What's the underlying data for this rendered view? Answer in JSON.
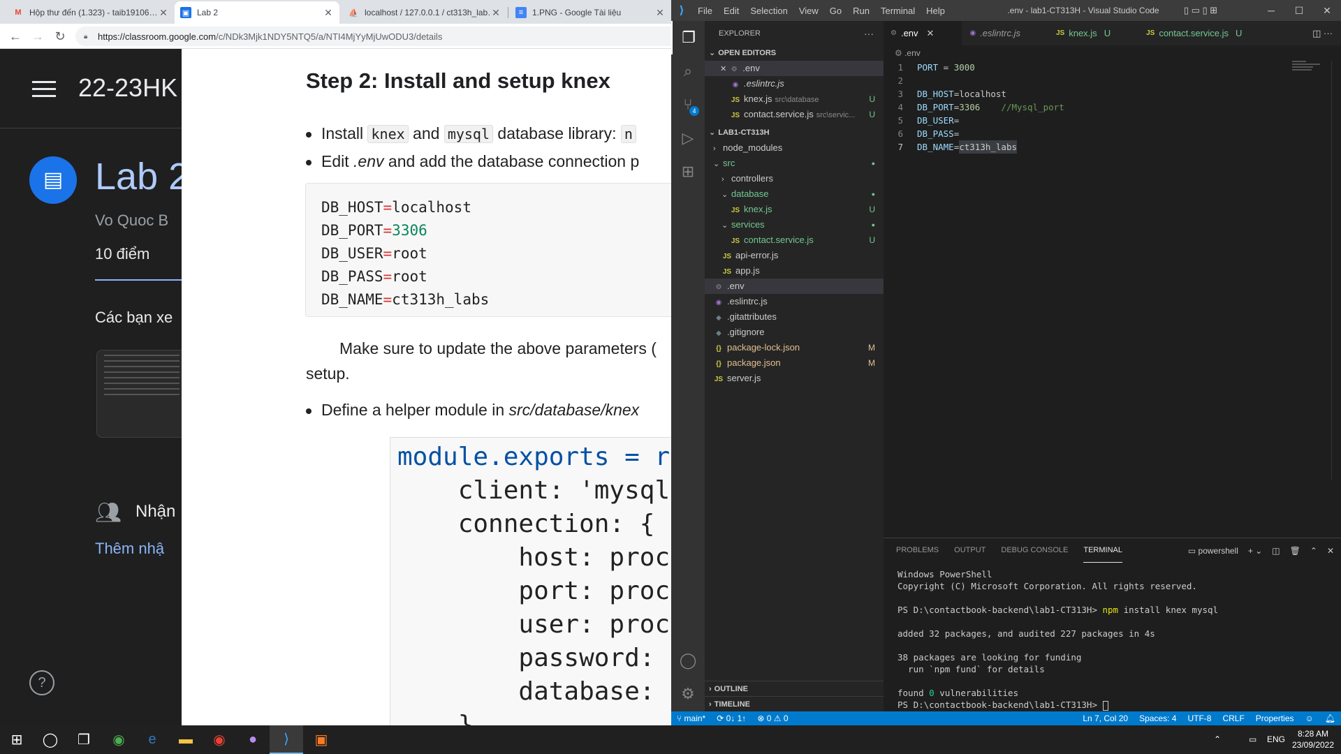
{
  "chrome": {
    "tabs": [
      {
        "title": "Hộp thư đến (1.323) - taib19106…",
        "icon": "gmail-icon"
      },
      {
        "title": "Lab 2",
        "icon": "classroom-icon"
      },
      {
        "title": "localhost / 127.0.0.1 / ct313h_lab…",
        "icon": "phpmyadmin-icon"
      },
      {
        "title": "1.PNG - Google Tài liệu",
        "icon": "docs-icon"
      }
    ],
    "url_host": "https://classroom.google.com",
    "url_path": "/c/NDk3Mjk1NDY5NTQ5/a/NTI4MjYyMjUwODU3/details"
  },
  "classroom": {
    "course": "22-23HK",
    "title": "Lab 2",
    "author": "Vo Quoc B",
    "points": "10 điểm",
    "desc": "Các bạn xe",
    "people": "Nhận",
    "add_comment": "Thêm nhậ",
    "help": "?"
  },
  "doc": {
    "heading": "Step 2: Install and setup knex",
    "b1_pre": "Install",
    "b1_c1": "knex",
    "b1_and": "and",
    "b1_c2": "mysql",
    "b1_post": "database library:",
    "b1_c3": "n",
    "b2_pre": "Edit",
    "b2_file": ".env",
    "b2_post": "and add the database connection p",
    "env": [
      {
        "k": "DB_HOST",
        "v": "localhost",
        "num": false
      },
      {
        "k": "DB_PORT",
        "v": "3306",
        "num": true
      },
      {
        "k": "DB_USER",
        "v": "root",
        "num": false
      },
      {
        "k": "DB_PASS",
        "v": "root",
        "num": false
      },
      {
        "k": "DB_NAME",
        "v": "ct313h_labs",
        "num": false
      }
    ],
    "p1": "Make sure to update the above parameters (",
    "p2": "setup.",
    "b3_pre": "Define a helper module in",
    "b3_path": "src/database/knex",
    "code_lines": [
      "module.exports = re",
      "    client: 'mysql'",
      "    connection: {",
      "        host: proce",
      "        port: proce",
      "        user: proce",
      "        password: p",
      "        database: p",
      "    }"
    ]
  },
  "vscode": {
    "menu": [
      "File",
      "Edit",
      "Selection",
      "View",
      "Go",
      "Run",
      "Terminal",
      "Help"
    ],
    "window_title": ".env - lab1-CT313H - Visual Studio Code",
    "explorer_label": "EXPLORER",
    "open_editors_label": "OPEN EDITORS",
    "open_editors": [
      {
        "name": ".env",
        "desc": "",
        "status": "",
        "icon": "gear"
      },
      {
        "name": ".eslintrc.js",
        "desc": "",
        "status": "",
        "icon": "eslint"
      },
      {
        "name": "knex.js",
        "desc": "src\\database",
        "status": "U",
        "icon": "js"
      },
      {
        "name": "contact.service.js",
        "desc": "src\\servic...",
        "status": "U",
        "icon": "js"
      }
    ],
    "project_label": "LAB1-CT313H",
    "tree": [
      {
        "name": "node_modules",
        "indent": 1,
        "chev": "›",
        "icon": "",
        "status": ""
      },
      {
        "name": "src",
        "indent": 1,
        "chev": "⌄",
        "icon": "",
        "status": "●"
      },
      {
        "name": "controllers",
        "indent": 2,
        "chev": "›",
        "icon": "",
        "status": ""
      },
      {
        "name": "database",
        "indent": 2,
        "chev": "⌄",
        "icon": "",
        "status": "●"
      },
      {
        "name": "knex.js",
        "indent": 3,
        "chev": "",
        "icon": "JS",
        "status": "U"
      },
      {
        "name": "services",
        "indent": 2,
        "chev": "⌄",
        "icon": "",
        "status": "●"
      },
      {
        "name": "contact.service.js",
        "indent": 3,
        "chev": "",
        "icon": "JS",
        "status": "U"
      },
      {
        "name": "api-error.js",
        "indent": 2,
        "chev": "",
        "icon": "JS",
        "status": ""
      },
      {
        "name": "app.js",
        "indent": 2,
        "chev": "",
        "icon": "JS",
        "status": ""
      },
      {
        "name": ".env",
        "indent": 1,
        "chev": "",
        "icon": "⚙",
        "status": ""
      },
      {
        "name": ".eslintrc.js",
        "indent": 1,
        "chev": "",
        "icon": "◉",
        "status": ""
      },
      {
        "name": ".gitattributes",
        "indent": 1,
        "chev": "",
        "icon": "◆",
        "status": ""
      },
      {
        "name": ".gitignore",
        "indent": 1,
        "chev": "",
        "icon": "◆",
        "status": ""
      },
      {
        "name": "package-lock.json",
        "indent": 1,
        "chev": "",
        "icon": "{}",
        "status": "M"
      },
      {
        "name": "package.json",
        "indent": 1,
        "chev": "",
        "icon": "{}",
        "status": "M"
      },
      {
        "name": "server.js",
        "indent": 1,
        "chev": "",
        "icon": "JS",
        "status": ""
      }
    ],
    "outline_label": "OUTLINE",
    "timeline_label": "TIMELINE",
    "editor_tabs": [
      {
        "name": ".env",
        "status": ""
      },
      {
        "name": ".eslintrc.js",
        "status": ""
      },
      {
        "name": "knex.js",
        "status": "U"
      },
      {
        "name": "contact.service.js",
        "status": "U"
      }
    ],
    "breadcrumb": ".env",
    "lines": [
      {
        "key": "PORT",
        "sep": " = ",
        "val": "3000",
        "comment": ""
      },
      {
        "key": "",
        "sep": "",
        "val": "",
        "comment": ""
      },
      {
        "key": "DB_HOST",
        "sep": "=",
        "val": "localhost",
        "comment": ""
      },
      {
        "key": "DB_PORT",
        "sep": "=",
        "val": "3306",
        "comment": "    //Mysql_port"
      },
      {
        "key": "DB_USER",
        "sep": "=",
        "val": "",
        "comment": ""
      },
      {
        "key": "DB_PASS",
        "sep": "=",
        "val": "",
        "comment": ""
      },
      {
        "key": "DB_NAME",
        "sep": "=",
        "val": "ct313h_labs",
        "comment": ""
      }
    ],
    "panel_tabs": [
      "PROBLEMS",
      "OUTPUT",
      "DEBUG CONSOLE",
      "TERMINAL"
    ],
    "shell": "powershell",
    "terminal": [
      "Windows PowerShell",
      "Copyright (C) Microsoft Corporation. All rights reserved.",
      "",
      "PS D:\\contactbook-backend\\lab1-CT313H> npm install knex mysql",
      "",
      "added 32 packages, and audited 227 packages in 4s",
      "",
      "38 packages are looking for funding",
      "  run `npm fund` for details",
      "",
      "found 0 vulnerabilities",
      "PS D:\\contactbook-backend\\lab1-CT313H> "
    ],
    "status": {
      "branch": "main*",
      "sync": "0↓ 1↑",
      "errors": "0",
      "warnings": "0",
      "position": "Ln 7, Col 20",
      "spaces": "Spaces: 4",
      "encoding": "UTF-8",
      "eol": "CRLF",
      "lang": "Properties"
    }
  },
  "taskbar": {
    "lang": "ENG",
    "time": "8:28 AM",
    "date": "23/09/2022"
  }
}
